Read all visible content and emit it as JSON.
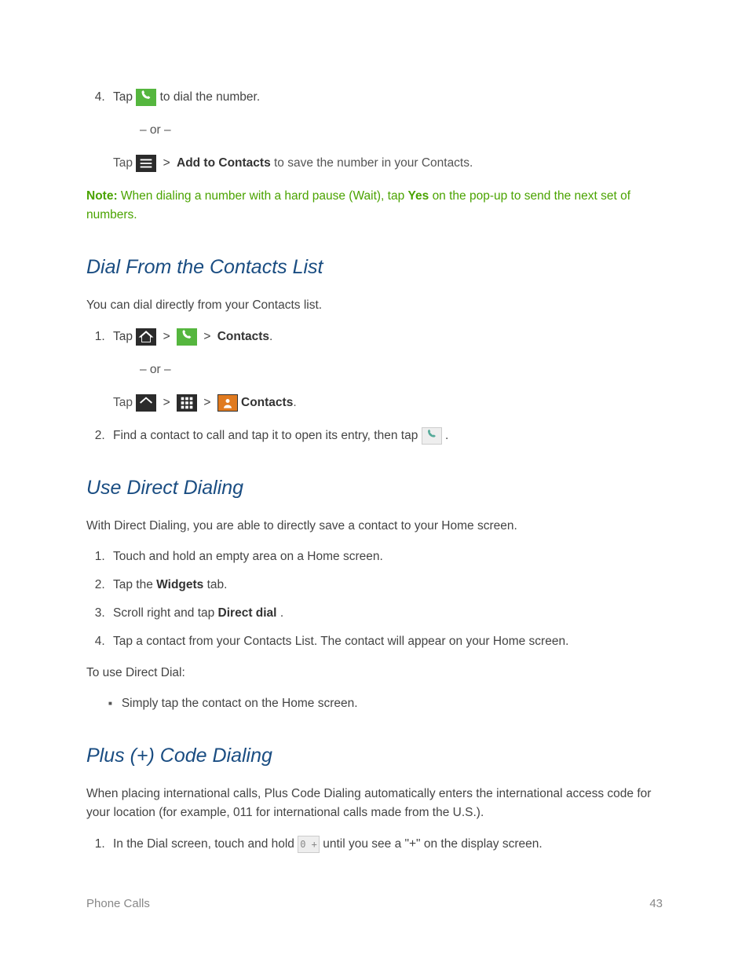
{
  "step4": {
    "num": "4.",
    "tap": "Tap",
    "after_icon": " to dial the number.",
    "or": "– or –",
    "tap2": "Tap",
    "add_contacts": "Add to Contacts",
    "after_add": " to save the number in your Contacts."
  },
  "note": {
    "label": "Note:",
    "pre": "  When dialing a number with a hard pause (Wait), tap ",
    "yes": "Yes",
    "post": " on the pop-up to send the next set of numbers."
  },
  "sec1": {
    "heading": "Dial From the Contacts List",
    "intro": "You can dial directly from your Contacts list.",
    "s1_num": "1.",
    "s1_tap": "Tap",
    "s1_contacts": "Contacts",
    "or": "– or –",
    "s1b_tap": "Tap",
    "s1b_contacts": "Contacts",
    "s2_num": "2.",
    "s2_text_pre": "Find a contact to call and tap it to open its entry, then tap ",
    "s2_text_post": "."
  },
  "sec2": {
    "heading": "Use Direct Dialing",
    "intro": "With Direct Dialing, you are able to directly save a contact to your Home screen.",
    "s1": "Touch and hold an empty area on a Home screen.",
    "s2_pre": "Tap the ",
    "s2_bold": "Widgets",
    "s2_post": " tab.",
    "s3_pre": "Scroll right and tap ",
    "s3_bold": "Direct dial",
    "s3_post": ".",
    "s4": "Tap a contact from your Contacts List. The contact will appear on your Home screen.",
    "to_use": "To use Direct Dial:",
    "bullet": "Simply tap the contact on the Home screen."
  },
  "sec3": {
    "heading": "Plus (+) Code Dialing",
    "intro": "When placing international calls, Plus Code Dialing automatically enters the international access code for your location (for example, 011 for international calls made from the U.S.).",
    "s1_pre": "In the Dial screen, touch and hold ",
    "s1_key": "0 +",
    "s1_post": " until you see a \"+\" on the display screen."
  },
  "footer": {
    "left": "Phone Calls",
    "right": "43"
  }
}
